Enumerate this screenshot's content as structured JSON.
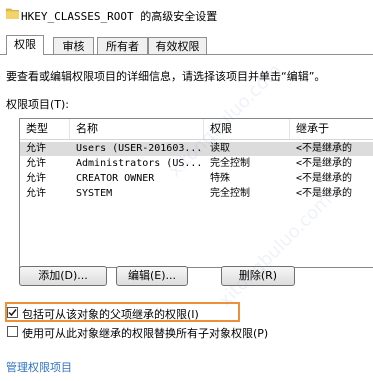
{
  "window": {
    "title": "HKEY_CLASSES_ROOT 的高级安全设置"
  },
  "tabs": [
    {
      "label": "权限",
      "active": true
    },
    {
      "label": "审核",
      "active": false
    },
    {
      "label": "所有者",
      "active": false
    },
    {
      "label": "有效权限",
      "active": false
    }
  ],
  "description": "要查看或编辑权限项目的详细信息，请选择该项目并单击“编辑”。",
  "permission_items_label": "权限项目(T):",
  "table": {
    "columns": [
      "类型",
      "名称",
      "权限",
      "继承于"
    ],
    "rows": [
      [
        "允许",
        "Users (USER-201603...",
        "读取",
        "<不是继承的"
      ],
      [
        "允许",
        "Administrators (US...",
        "完全控制",
        "<不是继承的"
      ],
      [
        "允许",
        "CREATOR OWNER",
        "特殊",
        "<不是继承的"
      ],
      [
        "允许",
        "SYSTEM",
        "完全控制",
        "<不是继承的"
      ]
    ]
  },
  "buttons": {
    "add": "添加(D)...",
    "edit": "编辑(E)...",
    "remove": "删除(R)"
  },
  "checkboxes": {
    "include_inheritable": {
      "label": "包括可从该对象的父项继承的权限(I)",
      "checked": true
    },
    "replace_child": {
      "label": "使用可从此对象继承的权限替换所有子对象权限(P)",
      "checked": false
    }
  },
  "link": "管理权限项目"
}
